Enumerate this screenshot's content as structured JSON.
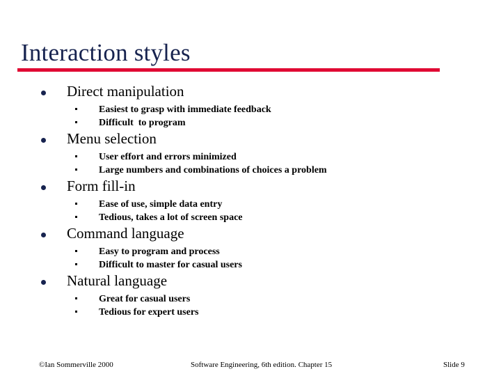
{
  "slide": {
    "title": "Interaction styles",
    "colors": {
      "title_navy": "#17234f",
      "rule_red": "#e00a34",
      "body_text": "#000000",
      "background": "#ffffff"
    },
    "sections": [
      {
        "heading": "Direct manipulation",
        "points": [
          "Easiest to grasp with immediate feedback",
          "Difficult  to program"
        ]
      },
      {
        "heading": "Menu selection",
        "points": [
          "User effort and errors minimized",
          "Large numbers and combinations of choices a problem"
        ]
      },
      {
        "heading": "Form fill-in",
        "points": [
          "Ease of use, simple data entry",
          "Tedious, takes a lot of screen space"
        ]
      },
      {
        "heading": "Command language",
        "points": [
          "Easy to program and process",
          "Difficult to master for casual users"
        ]
      },
      {
        "heading": "Natural language",
        "points": [
          "Great for casual users",
          "Tedious for expert users"
        ]
      }
    ],
    "footer": {
      "left": "©Ian Sommerville 2000",
      "center": "Software Engineering, 6th edition. Chapter 15",
      "right": "Slide 9"
    }
  }
}
